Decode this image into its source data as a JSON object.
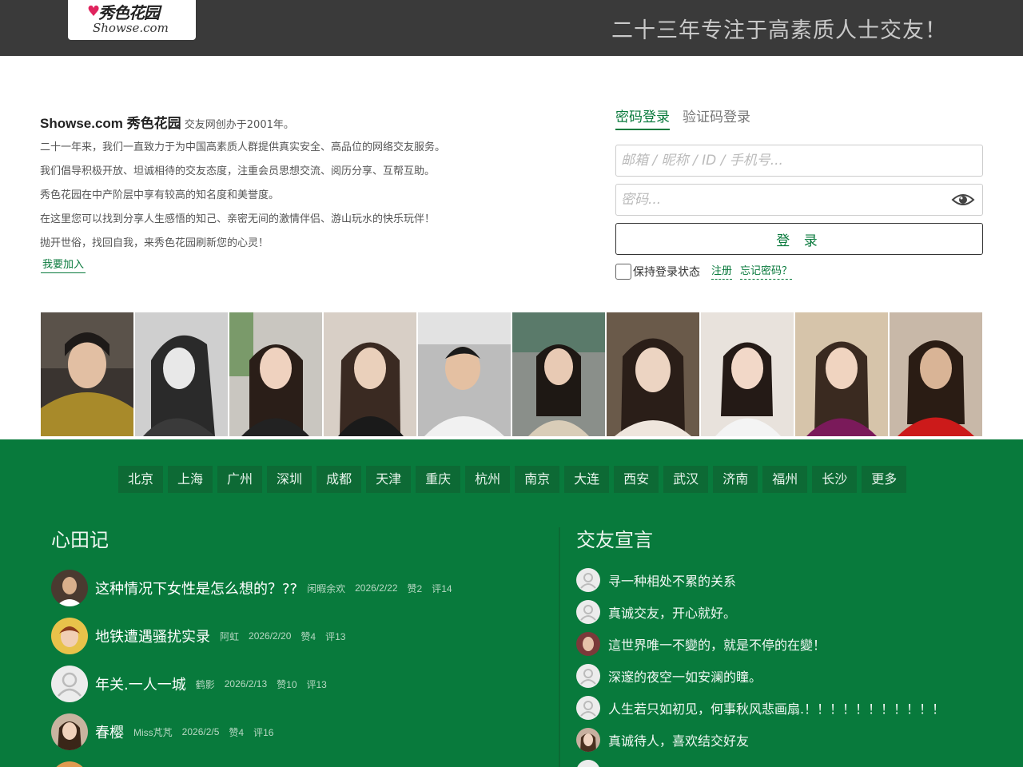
{
  "header": {
    "logo_cn": "秀色花园",
    "logo_en": "Showse.com",
    "slogan": "二十三年专注于高素质人士交友！"
  },
  "intro": {
    "title_bold": "Showse.com 秀色花园",
    "title_rest": "交友网创办于2001年。",
    "lines": [
      "二十一年来，我们一直致力于为中国高素质人群提供真实安全、高品位的网络交友服务。",
      "我们倡导积极开放、坦诚相待的交友态度，注重会员思想交流、阅历分享、互帮互助。",
      "秀色花园在中产阶层中享有较高的知名度和美誉度。",
      "在这里您可以找到分享人生感悟的知己、亲密无间的激情伴侣、游山玩水的快乐玩伴！",
      "抛开世俗，找回自我，来秀色花园刷新您的心灵！"
    ],
    "join_label": "我要加入"
  },
  "login": {
    "tab_password": "密码登录",
    "tab_code": "验证码登录",
    "account_placeholder": "邮箱 / 昵称 / ID / 手机号...",
    "password_placeholder": "密码...",
    "submit_label": "登 录",
    "remember_label": "保持登录状态",
    "register_label": "注册",
    "forgot_label": "忘记密码？"
  },
  "cities": [
    "北京",
    "上海",
    "广州",
    "深圳",
    "成都",
    "天津",
    "重庆",
    "杭州",
    "南京",
    "大连",
    "西安",
    "武汉",
    "济南",
    "福州",
    "长沙",
    "更多"
  ],
  "diary": {
    "title": "心田记",
    "items": [
      {
        "title": "这种情况下女性是怎么想的？??",
        "author": "闲暇余欢",
        "date": "2026/2/22",
        "likes": "赞2",
        "comments": "评14"
      },
      {
        "title": "地铁遭遇骚扰实录",
        "author": "阿虹",
        "date": "2026/2/20",
        "likes": "赞4",
        "comments": "评13"
      },
      {
        "title": "年关.一人一城",
        "author": "鹤影",
        "date": "2026/2/13",
        "likes": "赞10",
        "comments": "评13"
      },
      {
        "title": "春樱",
        "author": "Miss芃芃",
        "date": "2026/2/5",
        "likes": "赞4",
        "comments": "评16"
      }
    ]
  },
  "declarations": {
    "title": "交友宣言",
    "items": [
      "寻一种相处不累的关系",
      "真诚交友，开心就好。",
      "這世界唯一不變的，就是不停的在變！",
      "深邃的夜空一如安澜的瞳。",
      "人生若只如初见，何事秋风悲画扇.！！！！！！！！！！！",
      "真诚待人，喜欢结交好友"
    ]
  },
  "colors": {
    "header_bg": "#3a3a3a",
    "brand_green": "#087a3c",
    "city_bg": "#0d6a35",
    "link_green": "#0a7a3d"
  }
}
